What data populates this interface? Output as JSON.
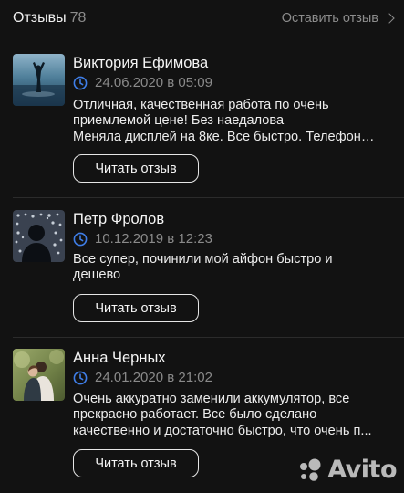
{
  "header": {
    "title": "Отзывы",
    "count": "78",
    "action_label": "Оставить отзыв",
    "chevron_icon": "chevron-right-icon"
  },
  "reviews": [
    {
      "name": "Виктория Ефимова",
      "date": "24.06.2020",
      "time_sep": "в",
      "time": "05:09",
      "text": "Отличная, качественная работа по очень\nприемлемой цене! Без наедалова\nМеняла дисплей на 8ке. Все быстро. Телефон…",
      "button_label": "Читать отзыв",
      "avatar": "person-in-water-photo"
    },
    {
      "name": "Петр Фролов",
      "date": "10.12.2019",
      "time_sep": "в",
      "time": "12:23",
      "text": "Все супер, починили мой айфон быстро и\nдешево",
      "button_label": "Читать отзыв",
      "avatar": "silhouette-with-lights-photo"
    },
    {
      "name": "Анна Черных",
      "date": "24.01.2020",
      "time_sep": "в",
      "time": "21:02",
      "text": "Очень аккуратно заменили аккумулятор, все\nпрекрасно работает. Все было сделано\nкачественно и достаточно быстро, что очень п...",
      "button_label": "Читать отзыв",
      "avatar": "couple-outdoors-photo"
    }
  ],
  "watermark": {
    "logo_icon": "avito-dots-icon",
    "text": "Avito"
  },
  "colors": {
    "background": "#121212",
    "muted": "#8a8a8a",
    "clock_accent": "#3f7ee8"
  }
}
